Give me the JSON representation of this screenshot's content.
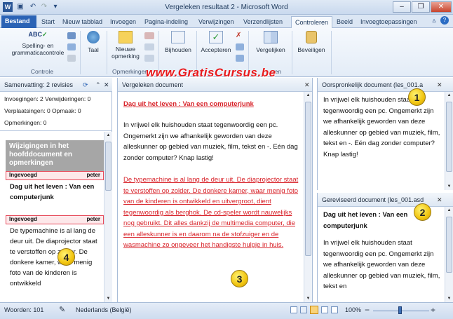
{
  "window": {
    "title": "Vergeleken resultaat 2  -  Microsoft Word",
    "minimize": "–",
    "maximize": "❐",
    "close": "✕"
  },
  "tabs": [
    "Bestand",
    "Start",
    "Nieuw tabblad",
    "Invoegen",
    "Pagina-indeling",
    "Verwijzingen",
    "Verzendlijsten",
    "Controleren",
    "Beeld",
    "Invoegtoepassingen"
  ],
  "ribbon": {
    "spelling": "Spelling- en grammaticacontrole",
    "taal": "Taal",
    "nieuwe_opmerking": "Nieuwe opmerking",
    "bijhouden": "Bijhouden",
    "accepteren": "Accepteren",
    "vergelijken": "Vergelijken",
    "beveiligen": "Beveiligen",
    "group_controle": "Controle",
    "group_opmerkingen": "Opmerkingen",
    "group_partial": "ren"
  },
  "watermark": "www.GratisCursus.be",
  "summary": {
    "header": "Samenvatting: 2 revisies",
    "line1": "Invoegingen: 2  Verwijderingen: 0",
    "line2": "Verplaatsingen: 0  Opmaak: 0",
    "line3": "Opmerkingen: 0",
    "block_title": "Wijzigingen in het hoofddocument en opmerkingen",
    "ins1_label": "Ingevoegd",
    "ins1_user": "peter",
    "ins1_text": "Dag uit het leven : Van een computerjunk",
    "ins2_label": "Ingevoegd",
    "ins2_user": "peter",
    "ins2_text": "De typemachine is al lang de deur uit. De diaprojector staat te verstoffen op zolder. De donkere kamer, waar menig foto van de kinderen is ontwikkeld"
  },
  "compared": {
    "header": "Vergeleken document",
    "title": "Dag uit het leven : Van een computerjunk",
    "para1": "In vrijwel elk huishouden staat tegenwoordig een pc. Ongemerkt zijn we afhankelijk geworden van deze alleskunner op gebied van muziek, film, tekst en -. Eén dag zonder computer? Knap lastig!",
    "para2": "De typemachine is al lang de deur uit. De diaprojector staat te verstoffen op zolder. De donkere kamer, waar menig foto van de kinderen is ontwikkeld en uitvergroot, dient tegenwoordig als berghok. De cd-speler wordt nauwelijks nog gebruikt. Dit alles dankzij de multimedia computer, die een alleskunner is en daarom na de stofzuiger en de wasmachine zo ongeveer het handigste hulpje in huis."
  },
  "original": {
    "header": "Oorspronkelijk document (les_001.a",
    "para": "In vrijwel elk huishouden staat tegenwoordig een pc. Ongemerkt zijn we afhankelijk geworden van deze alleskunner op gebied van muziek, film, tekst en -. Eén dag zonder computer? Knap lastig!"
  },
  "revised": {
    "header": "Gereviseerd document (les_001.asd",
    "title": "Dag uit het leven : Van een computerjunk",
    "para": "In vrijwel elk huishouden staat tegenwoordig een pc. Ongemerkt zijn we afhankelijk geworden van deze alleskunner op gebied van muziek, film, tekst en"
  },
  "badges": [
    "1",
    "2",
    "3",
    "4"
  ],
  "status": {
    "words": "Woorden: 101",
    "language": "Nederlands (België)",
    "zoom": "100%",
    "zoom_minus": "−",
    "zoom_plus": "+"
  },
  "colors": {
    "insert_red": "#d8232a",
    "file_tab": "#2b63b5",
    "watermark": "#e8191c"
  }
}
